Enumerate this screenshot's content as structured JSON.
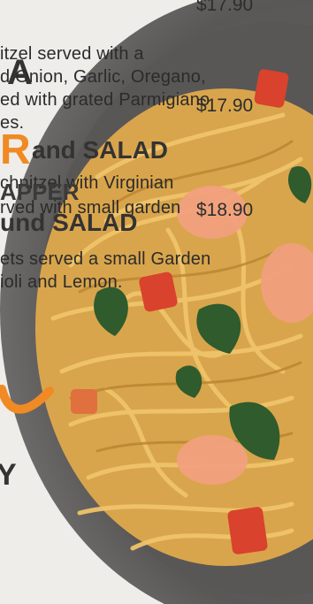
{
  "menu_text": {
    "price_top": "$17.90",
    "line1": "itzel served with a",
    "line2": "d Onion, Garlic, Oregano,",
    "line3": "ed with grated Parmigiano",
    "line4": "es.",
    "price_mid": "$17.90",
    "head1": "and SALAD",
    "head1_orange": "R",
    "line5": "chnitzel with Virginian",
    "overlay1": "APPER",
    "line6": "rved with small garden",
    "price_low": "$18.90",
    "head2": "und SALAD",
    "line7": "ets served a small Garden",
    "line8": "ioli and Lemon.",
    "orange_a": "A",
    "last_letter": "Y"
  },
  "colors": {
    "accent": "#f08a24",
    "plate_rim": "#8f8d8b",
    "plate_inner": "#5f5d5c",
    "noodle": "#e8b95c",
    "herb": "#2f5b2d",
    "tomato": "#d9422d"
  }
}
